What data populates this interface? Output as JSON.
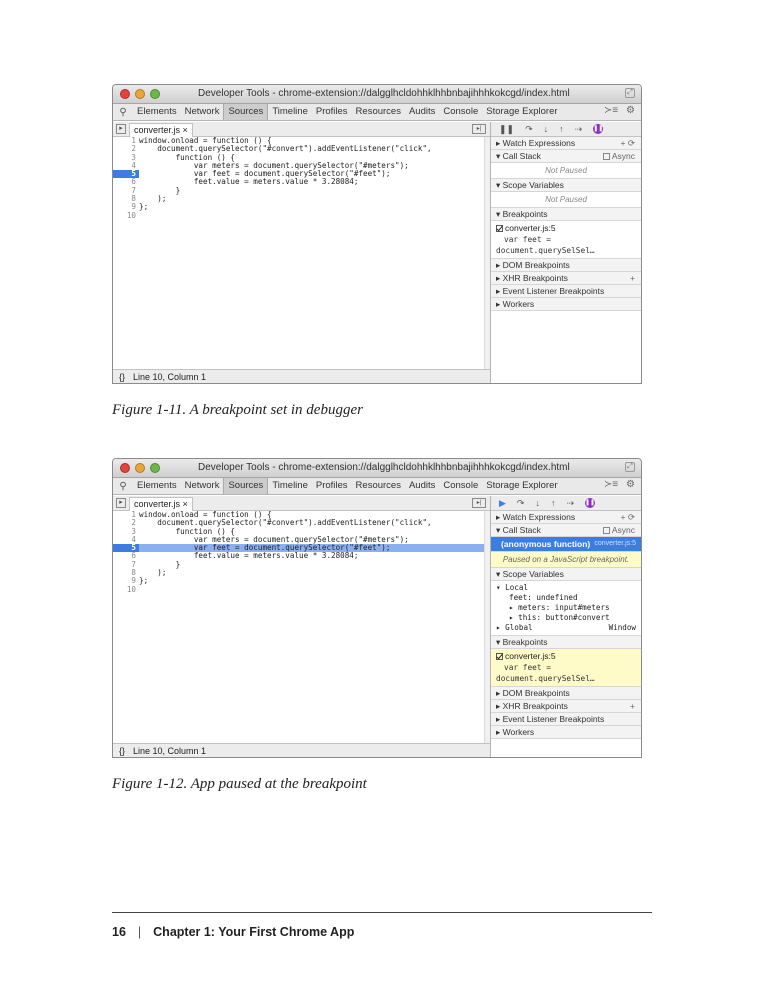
{
  "window_title": "Developer Tools - chrome-extension://dalgglhcldohhklhhbnbajihhhkokcgd/index.html",
  "toolbar_tabs": [
    "Elements",
    "Network",
    "Sources",
    "Timeline",
    "Profiles",
    "Resources",
    "Audits",
    "Console",
    "Storage Explorer"
  ],
  "active_tab": "Sources",
  "file_tab": "converter.js ×",
  "code": {
    "line_numbers": [
      "1",
      "2",
      "3",
      "4",
      "5",
      "6",
      "7",
      "8",
      "9",
      "10"
    ],
    "lines": [
      "window.onload = function () {",
      "    document.querySelector(\"#convert\").addEventListener(\"click\",",
      "        function () {",
      "            var meters = document.querySelector(\"#meters\");",
      "            var feet = document.querySelector(\"#feet\");",
      "            feet.value = meters.value * 3.28084;",
      "        }",
      "    );",
      "};",
      ""
    ]
  },
  "status_bar": {
    "icon": "{}",
    "text": "Line 10, Column 1"
  },
  "sidebar": {
    "watch": "Watch Expressions",
    "call_stack": "Call Stack",
    "async": "Async",
    "not_paused": "Not Paused",
    "scope_variables": "Scope Variables",
    "breakpoints": "Breakpoints",
    "bp_file": "converter.js:5",
    "bp_code": "var feet = document.querySelSel…",
    "dom_bp": "DOM Breakpoints",
    "xhr_bp": "XHR Breakpoints",
    "event_bp": "Event Listener Breakpoints",
    "workers": "Workers",
    "frame_name": "(anonymous function)",
    "frame_loc": "converter.js:5",
    "paused_msg": "Paused on a JavaScript breakpoint.",
    "scope_local": "Local",
    "scope_feet": "feet: undefined",
    "scope_meters": "meters: input#meters",
    "scope_this": "this: button#convert",
    "scope_global": "Global",
    "scope_window": "Window"
  },
  "captions": {
    "fig1": "Figure 1-11. A breakpoint set in debugger",
    "fig2": "Figure 1-12. App paused at the breakpoint"
  },
  "footer": {
    "page": "16",
    "sep": "|",
    "chapter": "Chapter 1: Your First Chrome App"
  }
}
